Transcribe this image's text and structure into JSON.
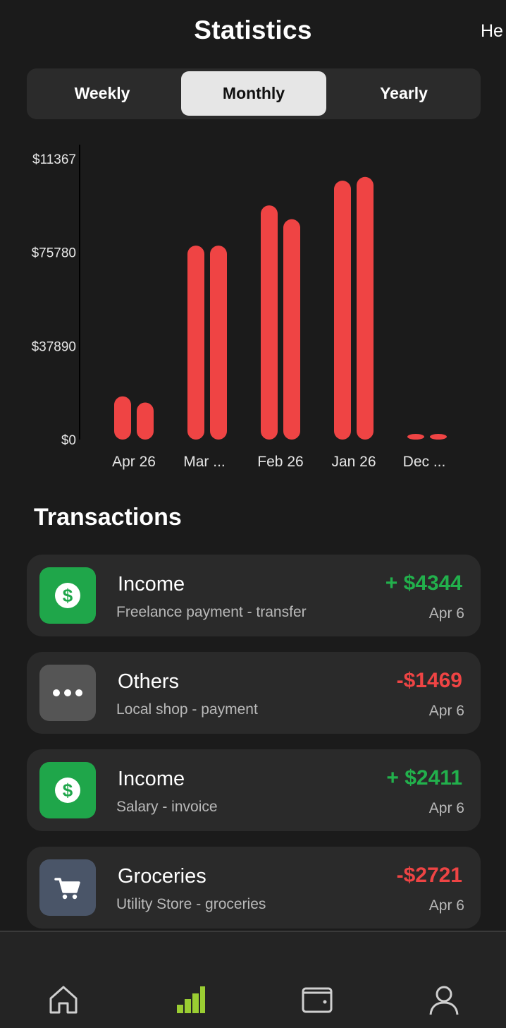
{
  "header": {
    "title": "Statistics",
    "peek_text": "He"
  },
  "period_tabs": [
    {
      "label": "Weekly",
      "active": false
    },
    {
      "label": "Monthly",
      "active": true
    },
    {
      "label": "Yearly",
      "active": false
    }
  ],
  "chart_data": {
    "type": "bar",
    "categories": [
      "Apr 26",
      "Mar ...",
      "Feb 26",
      "Jan 26",
      "Dec ..."
    ],
    "series": [
      {
        "values": [
          17500,
          78500,
          94800,
          104800,
          0
        ]
      },
      {
        "values": [
          15000,
          78500,
          89200,
          106300,
          0
        ]
      }
    ],
    "yticks": [
      "$0",
      "$37890",
      "$75780",
      "$11367"
    ],
    "ytick_values": [
      0,
      37890,
      75780,
      113670
    ],
    "ylim": [
      0,
      113670
    ],
    "color": "#ef4444",
    "grid": false
  },
  "transactions_section": {
    "title": "Transactions"
  },
  "transactions": [
    {
      "category": "Income",
      "description": "Freelance payment - transfer",
      "amount": "+ $4344",
      "date": "Apr 6",
      "icon": "dollar-circle-icon",
      "icon_bg": "#1fa64a",
      "kind": "pos"
    },
    {
      "category": "Others",
      "description": "Local shop - payment",
      "amount": "-$1469",
      "date": "Apr 6",
      "icon": "more-dots-icon",
      "icon_bg": "#555555",
      "kind": "neg"
    },
    {
      "category": "Income",
      "description": "Salary - invoice",
      "amount": "+ $2411",
      "date": "Apr 6",
      "icon": "dollar-circle-icon",
      "icon_bg": "#1fa64a",
      "kind": "pos"
    },
    {
      "category": "Groceries",
      "description": "Utility Store - groceries",
      "amount": "-$2721",
      "date": "Apr 6",
      "icon": "shopping-cart-icon",
      "icon_bg": "#4a5568",
      "kind": "neg"
    }
  ],
  "bottom_nav": [
    {
      "icon": "home-icon",
      "active": false
    },
    {
      "icon": "bar-chart-icon",
      "active": true
    },
    {
      "icon": "wallet-icon",
      "active": false
    },
    {
      "icon": "user-icon",
      "active": false
    }
  ],
  "colors": {
    "accent": "#9acd32",
    "positive": "#22b04c",
    "negative": "#ee4444",
    "bar": "#ef4444"
  }
}
